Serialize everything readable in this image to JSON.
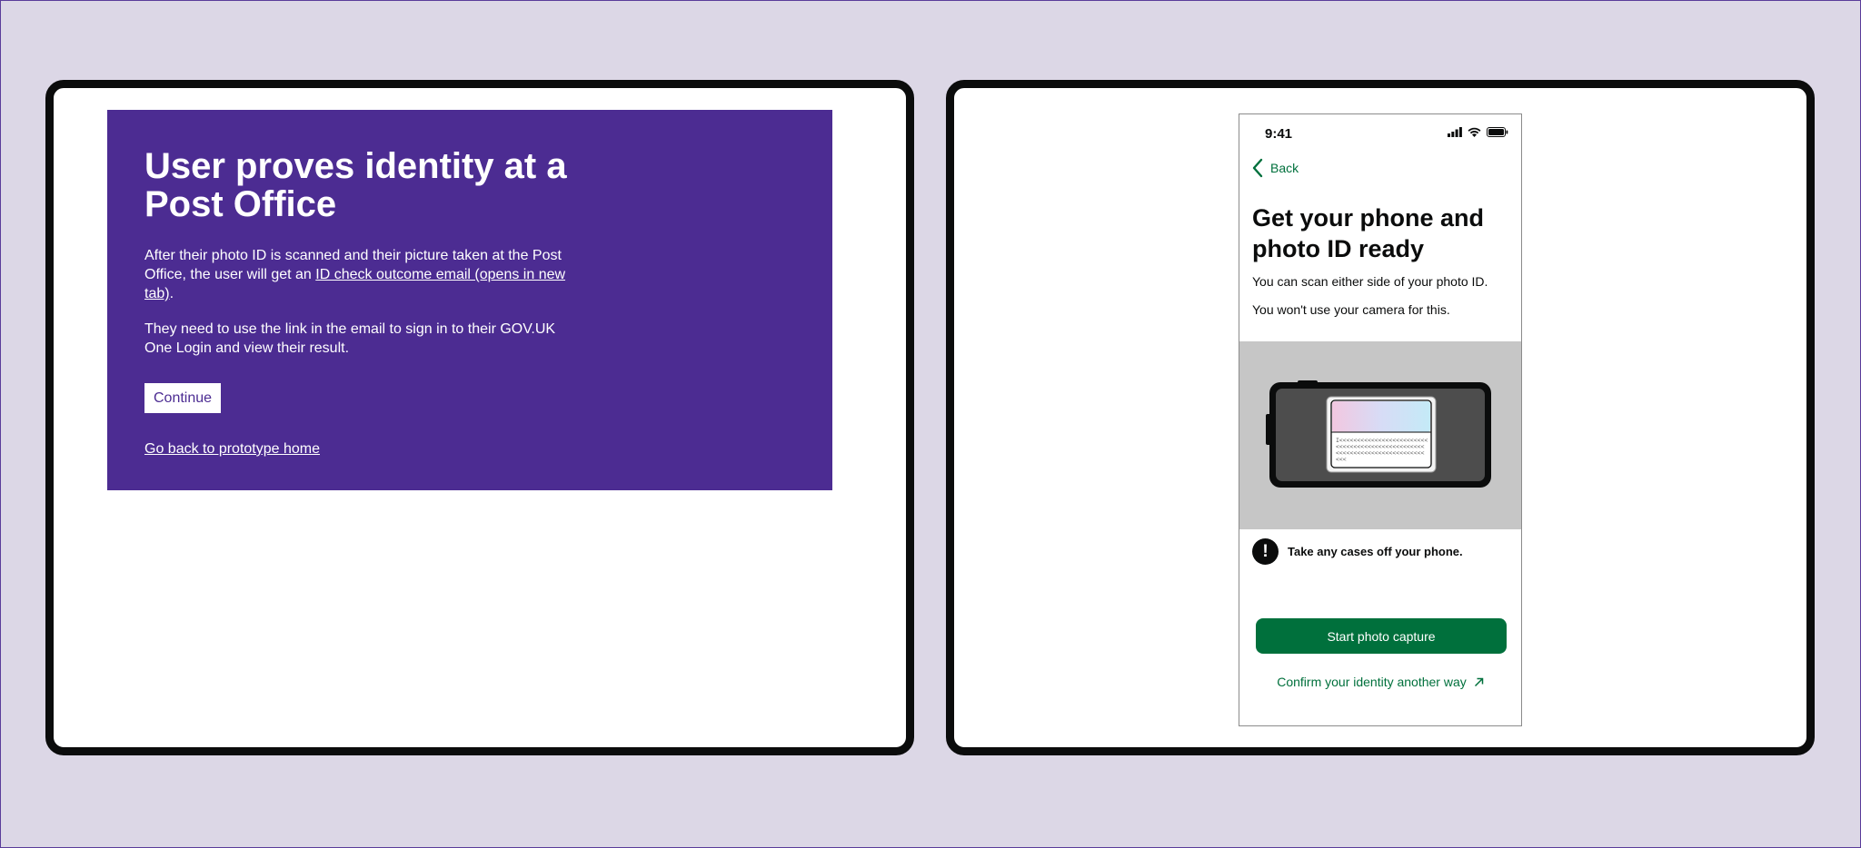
{
  "left": {
    "heading": "User proves identity at a Post Office",
    "para1_before": "After their photo ID is scanned and their picture taken at the Post Office, the user will get an ",
    "para1_link": "ID check outcome email (opens in new tab)",
    "para1_after": ".",
    "para2": "They need to use the link in the email to sign in to their GOV.UK One Login and view their result.",
    "continue_label": "Continue",
    "home_link": "Go back to prototype home"
  },
  "phone": {
    "time": "9:41",
    "back_label": "Back",
    "heading": "Get your phone and photo ID ready",
    "para1": "You can scan either side of your photo ID.",
    "para2": "You won't use your camera for this.",
    "warning": "Take any cases off your phone.",
    "start_button": "Start photo capture",
    "alt_link": "Confirm your identity another way",
    "mrz_lines": [
      "I<<<<<<<<<<<<<<<<<<<<<<<<<",
      "<<<<<<<<<<<<<<<<<<<<<<<<<",
      "<<<<<<<<<<<<<<<<<<<<<<<<<",
      "<<<"
    ]
  },
  "colors": {
    "background": "#dcd7e6",
    "purple": "#4c2c92",
    "green": "#00703c",
    "illustration_bg": "#c6c6c6",
    "black": "#0b0c0c"
  }
}
